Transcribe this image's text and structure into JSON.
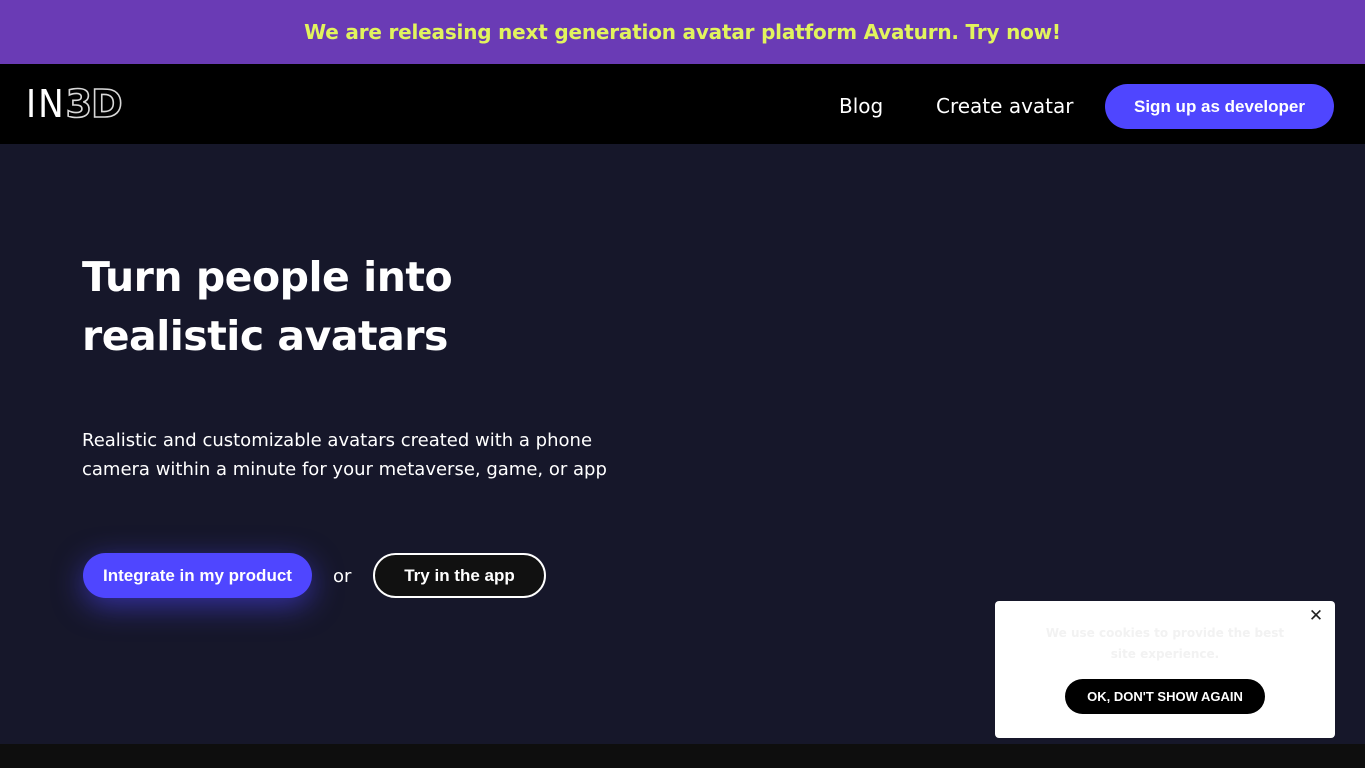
{
  "announcement": {
    "text": "We are releasing next generation avatar platform Avaturn. Try now!"
  },
  "nav": {
    "logo_light": "IN",
    "logo_3d": "3D",
    "links": [
      {
        "label": "Blog"
      },
      {
        "label": "Create avatar"
      }
    ],
    "signup_label": "Sign up as developer"
  },
  "hero": {
    "title": "Turn people into realistic avatars",
    "subtitle": "Realistic and customizable avatars created with a phone camera within a minute for your metaverse, game, or app",
    "primary_cta": "Integrate in my product",
    "separator": "or",
    "secondary_cta": "Try in the app"
  },
  "cookie": {
    "text": "We use cookies to provide the best site experience.",
    "button": "OK, DON'T SHOW AGAIN",
    "close_icon": "close-icon"
  },
  "colors": {
    "announcement_bg": "#6a3bb5",
    "announcement_text": "#e2f45d",
    "accent": "#4f46ff",
    "nav_bg": "#000000",
    "hero_bg": "#16172a"
  }
}
